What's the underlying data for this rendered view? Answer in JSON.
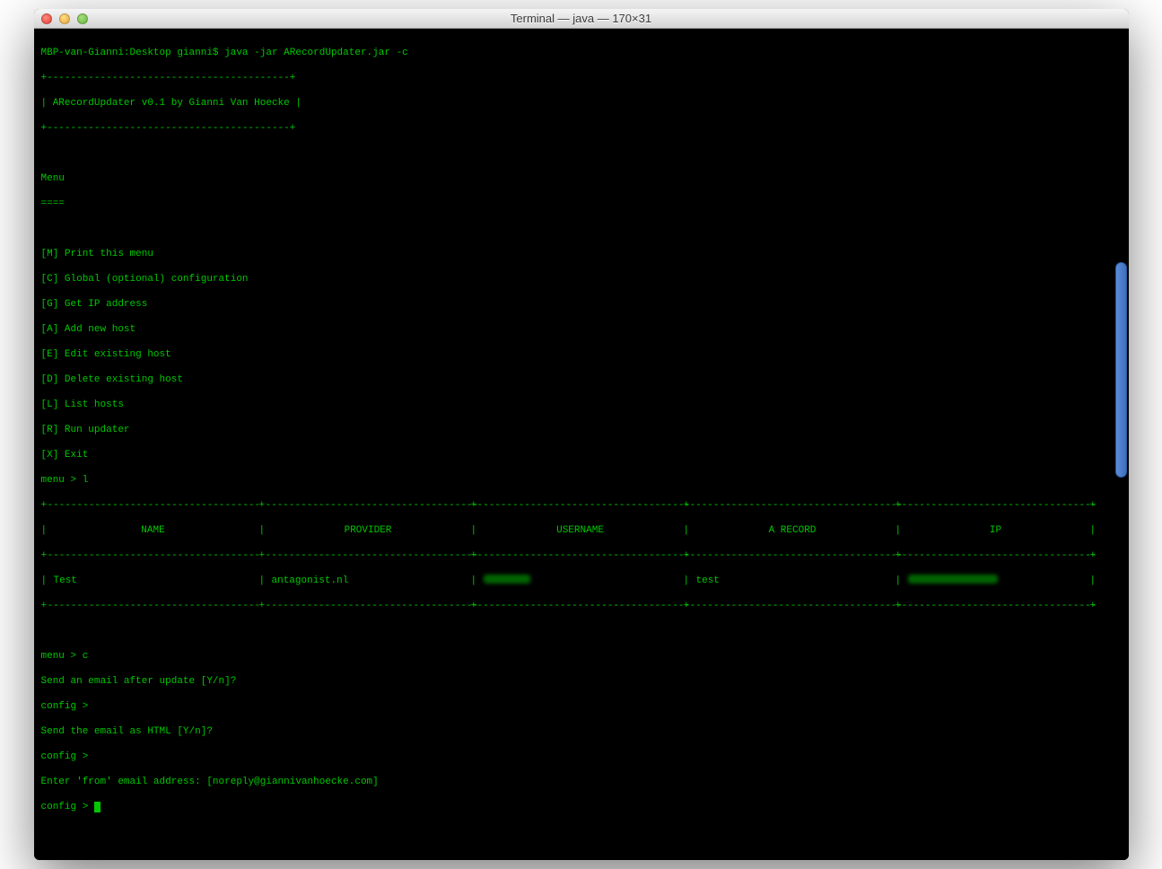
{
  "window": {
    "title": "Terminal — java — 170×31"
  },
  "prompt": "MBP-van-Gianni:Desktop gianni$ java -jar ARecordUpdater.jar -c",
  "boxTop": "+-----------------------------------------+",
  "boxMid": "| ARecordUpdater v0.1 by Gianni Van Hoecke |",
  "boxBottom": "+-----------------------------------------+",
  "menuHeader": "Menu",
  "menuUnderline": "====",
  "menuItems": [
    "[M] Print this menu",
    "[C] Global (optional) configuration",
    "[G] Get IP address",
    "[A] Add new host",
    "[E] Edit existing host",
    "[D] Delete existing host",
    "[L] List hosts",
    "[R] Run updater",
    "[X] Exit"
  ],
  "menuPrompt1": "menu > l",
  "tableHeaders": {
    "name": "NAME",
    "provider": "PROVIDER",
    "username": "USERNAME",
    "arecord": "A RECORD",
    "ip": "IP"
  },
  "tableRow": {
    "name": "Test",
    "provider": "antagonist.nl",
    "username_redacted": true,
    "arecord": "test",
    "ip_redacted": true
  },
  "menuPrompt2": "menu > c",
  "configLines": [
    "Send an email after update [Y/n]?",
    "config >",
    "Send the email as HTML [Y/n]?",
    "config >",
    "Enter 'from' email address: [noreply@giannivanhoecke.com]"
  ],
  "finalPrompt": "config > ",
  "bar": "|",
  "plus": "+",
  "tableRuleSeg": {
    "name": "------------------------------------",
    "provider": "------------------------------------",
    "username": "------------------------------------",
    "arecord": "------------------------------------",
    "ip": "---------------------------------"
  }
}
